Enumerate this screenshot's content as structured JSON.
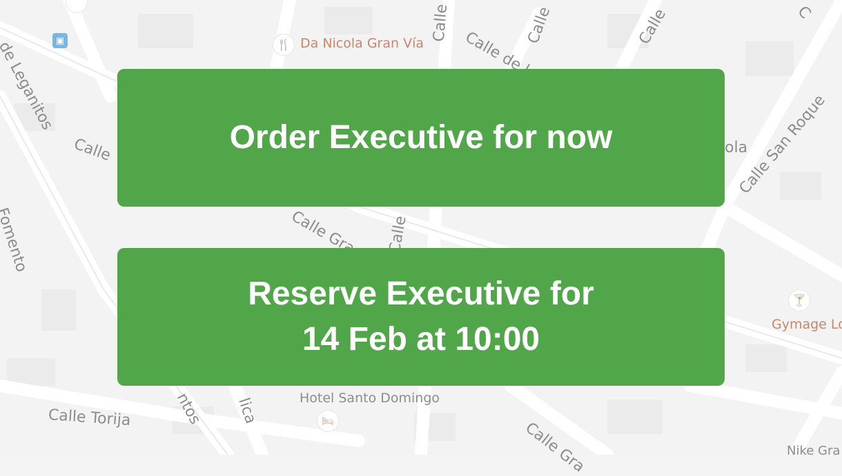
{
  "map": {
    "streets": [
      "de Leganitos",
      "Calle",
      "Fomento",
      "Calle de",
      "Calle de la",
      "Calle",
      "Calle",
      "Calle San Roque",
      "ola",
      "Calle Gran",
      "Calle",
      "C",
      "Calle Torija",
      "ntos",
      "lica",
      "Calle Gra",
      "Nike Gra"
    ],
    "pois": {
      "restaurant": "Da Nicola Gran Vía",
      "hotel": "Hotel Santo Domingo",
      "bar": "Gymage Lo"
    },
    "icons": {
      "restaurant": "restaurant-icon",
      "hotel": "bed-icon",
      "bar": "cocktail-icon",
      "bus": "bus-stop-icon"
    }
  },
  "actions": {
    "order_label": "Order Executive for now",
    "reserve_line1": "Reserve Executive for",
    "reserve_line2": "14 Feb at 10:00"
  },
  "colors": {
    "button": "#51a64a",
    "button_text": "#ffffff",
    "map_bg": "#f4f4f4",
    "road": "#ffffff"
  }
}
